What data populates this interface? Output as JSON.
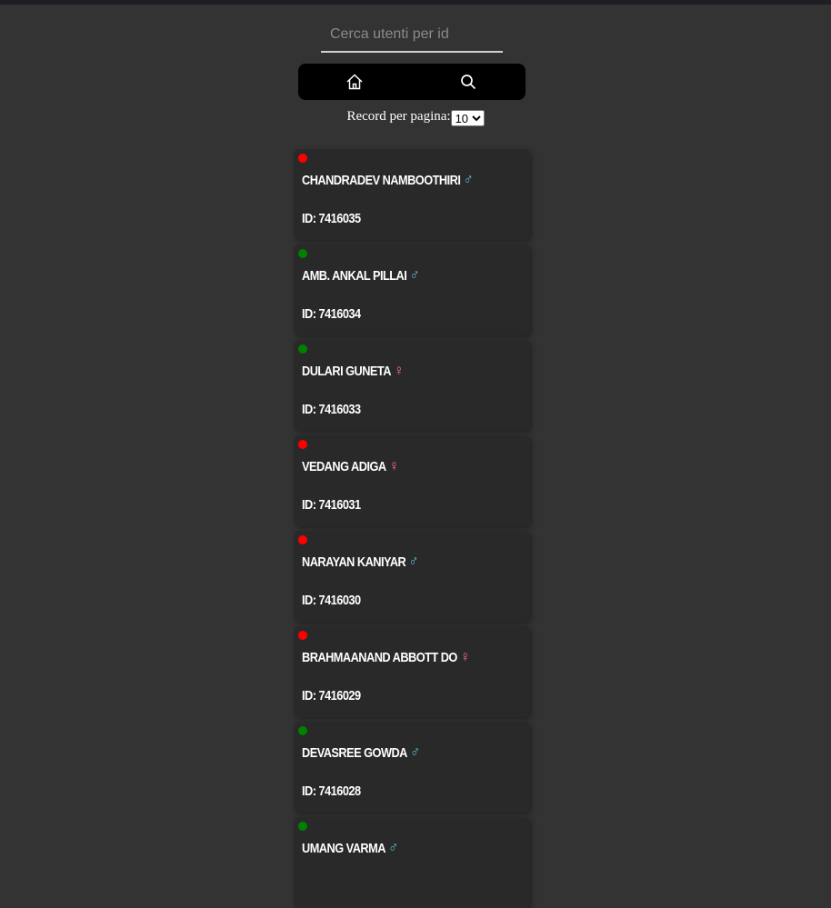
{
  "search": {
    "placeholder": "Cerca utenti per id",
    "value": ""
  },
  "nav": {
    "home_icon": "home-icon",
    "search_icon": "search-icon"
  },
  "pagination": {
    "label": "Record per pagina:",
    "selected": "10"
  },
  "colors": {
    "online": "#008000",
    "offline": "#ff0000",
    "male": "#5bc0de",
    "female": "#ff69b4"
  },
  "users": [
    {
      "name": "Chandradev Namboothiri",
      "gender_symbol": "♂",
      "gender": "male",
      "status": "offline",
      "id_label": "ID: 7416035"
    },
    {
      "name": "Amb. Ankal Pillai",
      "gender_symbol": "♂",
      "gender": "male",
      "status": "online",
      "id_label": "ID: 7416034"
    },
    {
      "name": "Dulari Guneta",
      "gender_symbol": "♀",
      "gender": "female",
      "status": "online",
      "id_label": "ID: 7416033"
    },
    {
      "name": "Vedang Adiga",
      "gender_symbol": "♀",
      "gender": "female",
      "status": "offline",
      "id_label": "ID: 7416031"
    },
    {
      "name": "Narayan Kaniyar",
      "gender_symbol": "♂",
      "gender": "male",
      "status": "offline",
      "id_label": "ID: 7416030"
    },
    {
      "name": "Brahmaanand Abbott DO",
      "gender_symbol": "♀",
      "gender": "female",
      "status": "offline",
      "id_label": "ID: 7416029"
    },
    {
      "name": "Devasree Gowda",
      "gender_symbol": "♂",
      "gender": "male",
      "status": "online",
      "id_label": "ID: 7416028"
    },
    {
      "name": "Umang Varma",
      "gender_symbol": "♂",
      "gender": "male",
      "status": "online",
      "id_label": ""
    }
  ]
}
